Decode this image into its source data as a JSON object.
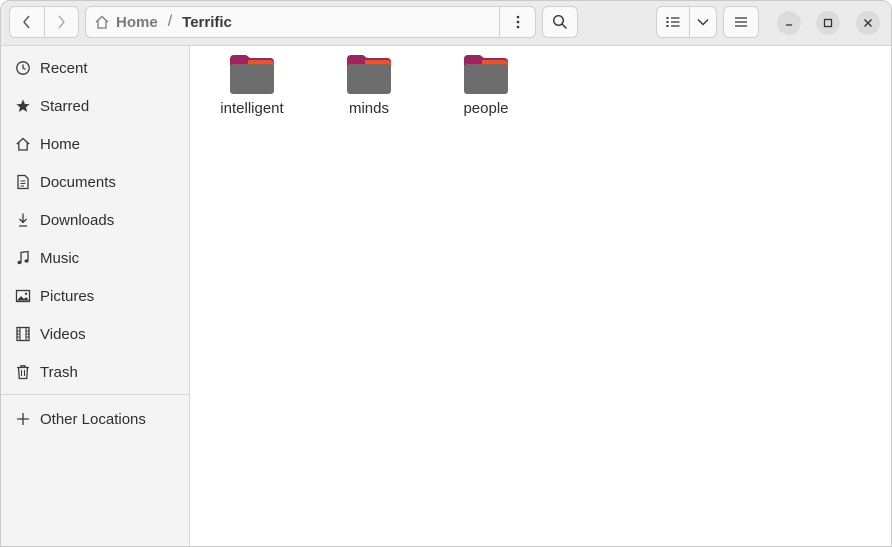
{
  "header": {
    "path": {
      "home_label": "Home",
      "separator": "/",
      "current": "Terrific"
    },
    "icons": {
      "back": "chevron-left-icon",
      "forward": "chevron-right-icon",
      "home": "home-icon",
      "path_menu": "vertical-dots-icon",
      "search": "search-icon",
      "view": "list-view-icon",
      "view_options": "chevron-down-icon",
      "menu": "hamburger-icon",
      "minimize": "minimize-icon",
      "maximize": "maximize-icon",
      "close": "close-icon"
    }
  },
  "sidebar": {
    "items": [
      {
        "label": "Recent",
        "icon": "clock-icon"
      },
      {
        "label": "Starred",
        "icon": "star-icon"
      },
      {
        "label": "Home",
        "icon": "home-icon"
      },
      {
        "label": "Documents",
        "icon": "document-icon"
      },
      {
        "label": "Downloads",
        "icon": "download-icon"
      },
      {
        "label": "Music",
        "icon": "music-note-icon"
      },
      {
        "label": "Pictures",
        "icon": "picture-icon"
      },
      {
        "label": "Videos",
        "icon": "film-icon"
      },
      {
        "label": "Trash",
        "icon": "trash-icon"
      }
    ],
    "other_locations": {
      "label": "Other Locations",
      "icon": "plus-icon"
    }
  },
  "files": [
    {
      "name": "intelligent",
      "icon": "folder-icon"
    },
    {
      "name": "minds",
      "icon": "folder-icon"
    },
    {
      "name": "people",
      "icon": "folder-icon"
    }
  ],
  "colors": {
    "folder_body": "#6d6d6d",
    "folder_tab": "#e95420",
    "folder_tab_accent": "#a0225f"
  }
}
